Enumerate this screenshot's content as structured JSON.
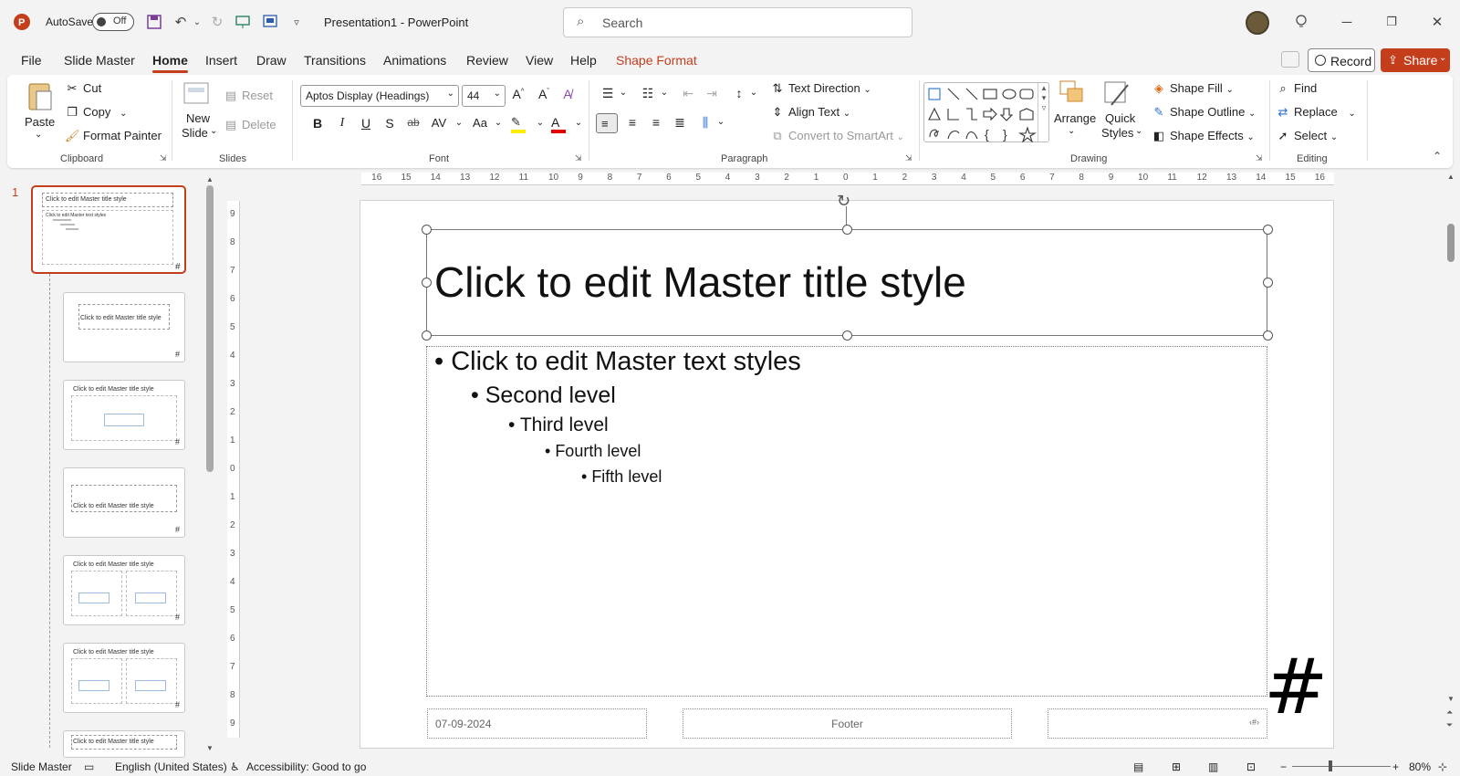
{
  "titlebar": {
    "autosave_label": "AutoSave",
    "autosave_state": "Off",
    "doc_title": "Presentation1 - PowerPoint",
    "search_placeholder": "Search"
  },
  "menu": {
    "tabs": [
      "File",
      "Slide Master",
      "Home",
      "Insert",
      "Draw",
      "Transitions",
      "Animations",
      "Review",
      "View",
      "Help",
      "Shape Format"
    ],
    "active": "Home",
    "record_label": "Record",
    "share_label": "Share"
  },
  "ribbon": {
    "clipboard": {
      "paste": "Paste",
      "cut": "Cut",
      "copy": "Copy",
      "format_painter": "Format Painter",
      "label": "Clipboard"
    },
    "slides": {
      "new_slide_1": "New",
      "new_slide_2": "Slide",
      "reset": "Reset",
      "delete": "Delete",
      "label": "Slides"
    },
    "font": {
      "family": "Aptos Display (Headings)",
      "size": "44",
      "label": "Font",
      "buttons": [
        "B",
        "I",
        "U",
        "S",
        "ab",
        "AV",
        "Aa"
      ]
    },
    "paragraph": {
      "text_direction": "Text Direction",
      "align_text": "Align Text",
      "convert_smartart": "Convert to SmartArt",
      "label": "Paragraph"
    },
    "drawing": {
      "arrange": "Arrange",
      "quick_styles_1": "Quick",
      "quick_styles_2": "Styles",
      "shape_fill": "Shape Fill",
      "shape_outline": "Shape Outline",
      "shape_effects": "Shape Effects",
      "label": "Drawing"
    },
    "editing": {
      "find": "Find",
      "replace": "Replace",
      "select": "Select",
      "label": "Editing"
    }
  },
  "thumbnails": {
    "selected_number": "1",
    "items": [
      {
        "title": "Click to edit Master title style",
        "sub": "Click to edit Master text styles"
      },
      {
        "title": "Click to edit Master title style"
      },
      {
        "title": "Click to edit Master title style"
      },
      {
        "title": "Click to edit Master title style"
      },
      {
        "title": "Click to edit Master title style"
      },
      {
        "title": "Click to edit Master title style"
      },
      {
        "title": "Click to edit Master title style"
      }
    ]
  },
  "ruler": {
    "h_ticks": [
      "16",
      "15",
      "14",
      "13",
      "12",
      "11",
      "10",
      "9",
      "8",
      "7",
      "6",
      "5",
      "4",
      "3",
      "2",
      "1",
      "0",
      "1",
      "2",
      "3",
      "4",
      "5",
      "6",
      "7",
      "8",
      "9",
      "10",
      "11",
      "12",
      "13",
      "14",
      "15",
      "16"
    ],
    "v_ticks": [
      "9",
      "8",
      "7",
      "6",
      "5",
      "4",
      "3",
      "2",
      "1",
      "0",
      "1",
      "2",
      "3",
      "4",
      "5",
      "6",
      "7",
      "8",
      "9"
    ]
  },
  "slide": {
    "title": "Click to edit Master title style",
    "levels": [
      "Click to edit Master text styles",
      "Second level",
      "Third level",
      "Fourth level",
      "Fifth level"
    ],
    "date": "07-09-2024",
    "footer": "Footer",
    "page_number_symbol": "‹#›",
    "big_hash": "#"
  },
  "status": {
    "view": "Slide Master",
    "language": "English (United States)",
    "accessibility": "Accessibility: Good to go",
    "zoom": "80%"
  },
  "colors": {
    "accent": "#c43e1c",
    "share_bg": "#c43e1c"
  }
}
